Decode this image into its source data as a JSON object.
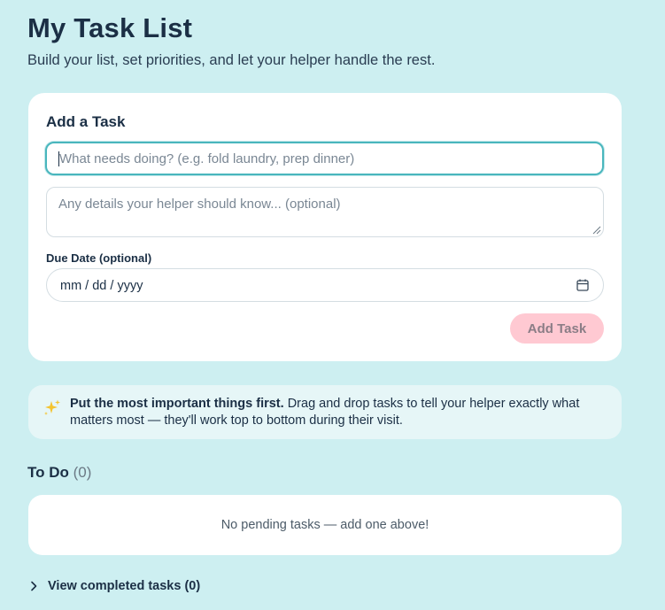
{
  "header": {
    "title": "My Task List",
    "subtitle": "Build your list, set priorities, and let your helper handle the rest."
  },
  "add_task": {
    "title": "Add a Task",
    "task_placeholder": "What needs doing? (e.g. fold laundry, prep dinner)",
    "task_value": "",
    "details_placeholder": "Any details your helper should know... (optional)",
    "details_value": "",
    "due_label": "Due Date (optional)",
    "due_placeholder": "mm / dd / yyyy",
    "button_label": "Add Task"
  },
  "tip": {
    "icon": "sparkles-icon",
    "bold": "Put the most important things first.",
    "text": " Drag and drop tasks to tell your helper exactly what matters most — they'll work top to bottom during their visit."
  },
  "todo": {
    "label": "To Do",
    "count": "(0)",
    "empty_message": "No pending tasks — add one above!"
  },
  "completed": {
    "label": "View completed tasks (0)",
    "icon": "chevron-right-icon"
  },
  "colors": {
    "background": "#cdeff1",
    "accent": "#49b6bd",
    "button_disabled": "#ffc9d2",
    "text": "#1b2f45"
  }
}
